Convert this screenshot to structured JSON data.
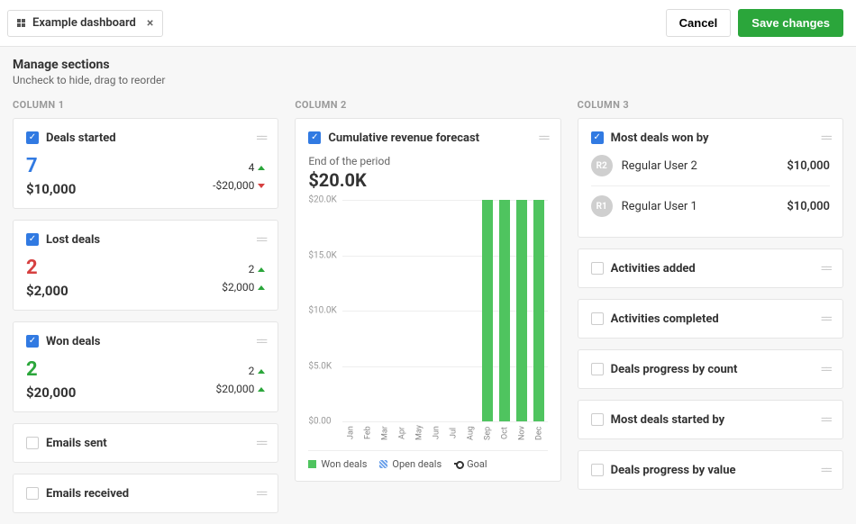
{
  "header": {
    "tab_title": "Example dashboard",
    "cancel": "Cancel",
    "save": "Save changes"
  },
  "manage": {
    "title": "Manage sections",
    "subtitle": "Uncheck to hide, drag to reorder"
  },
  "col_labels": [
    "COLUMN 1",
    "COLUMN 2",
    "COLUMN 3"
  ],
  "col1": {
    "deals_started": {
      "title": "Deals started",
      "big": "7",
      "sub": "$10,000",
      "mini1": "4",
      "mini2": "-$20,000"
    },
    "lost_deals": {
      "title": "Lost deals",
      "big": "2",
      "sub": "$2,000",
      "mini1": "2",
      "mini2": "$2,000"
    },
    "won_deals": {
      "title": "Won deals",
      "big": "2",
      "sub": "$20,000",
      "mini1": "2",
      "mini2": "$20,000"
    },
    "emails_sent": {
      "title": "Emails sent"
    },
    "emails_received": {
      "title": "Emails received"
    }
  },
  "col2": {
    "title": "Cumulative revenue forecast",
    "subtitle": "End of the period",
    "value": "$20.0K",
    "legend": {
      "won": "Won deals",
      "open": "Open deals",
      "goal": "Goal"
    }
  },
  "col3": {
    "most_won": {
      "title": "Most deals won by",
      "rows": [
        {
          "initials": "R2",
          "name": "Regular User 2",
          "value": "$10,000"
        },
        {
          "initials": "R1",
          "name": "Regular User 1",
          "value": "$10,000"
        }
      ]
    },
    "activities_added": {
      "title": "Activities added"
    },
    "activities_completed": {
      "title": "Activities completed"
    },
    "deals_progress_count": {
      "title": "Deals progress by count"
    },
    "most_started": {
      "title": "Most deals started by"
    },
    "deals_progress_value": {
      "title": "Deals progress by value"
    }
  },
  "chart_data": {
    "type": "bar",
    "title": "Cumulative revenue forecast",
    "ylabel": "",
    "ylim": [
      0,
      20000
    ],
    "yticks": [
      "$0.00",
      "$5.0K",
      "$10.0K",
      "$15.0K",
      "$20.0K"
    ],
    "categories": [
      "Jan",
      "Feb",
      "Mar",
      "Apr",
      "May",
      "Jun",
      "Jul",
      "Aug",
      "Sep",
      "Oct",
      "Nov",
      "Dec"
    ],
    "series": [
      {
        "name": "Won deals",
        "values": [
          0,
          0,
          0,
          0,
          0,
          0,
          0,
          0,
          20000,
          20000,
          20000,
          20000
        ]
      },
      {
        "name": "Open deals",
        "values": [
          0,
          0,
          0,
          0,
          0,
          0,
          0,
          0,
          0,
          0,
          0,
          0
        ]
      },
      {
        "name": "Goal",
        "values": [
          null,
          null,
          null,
          null,
          null,
          null,
          null,
          null,
          null,
          null,
          null,
          null
        ]
      }
    ]
  }
}
